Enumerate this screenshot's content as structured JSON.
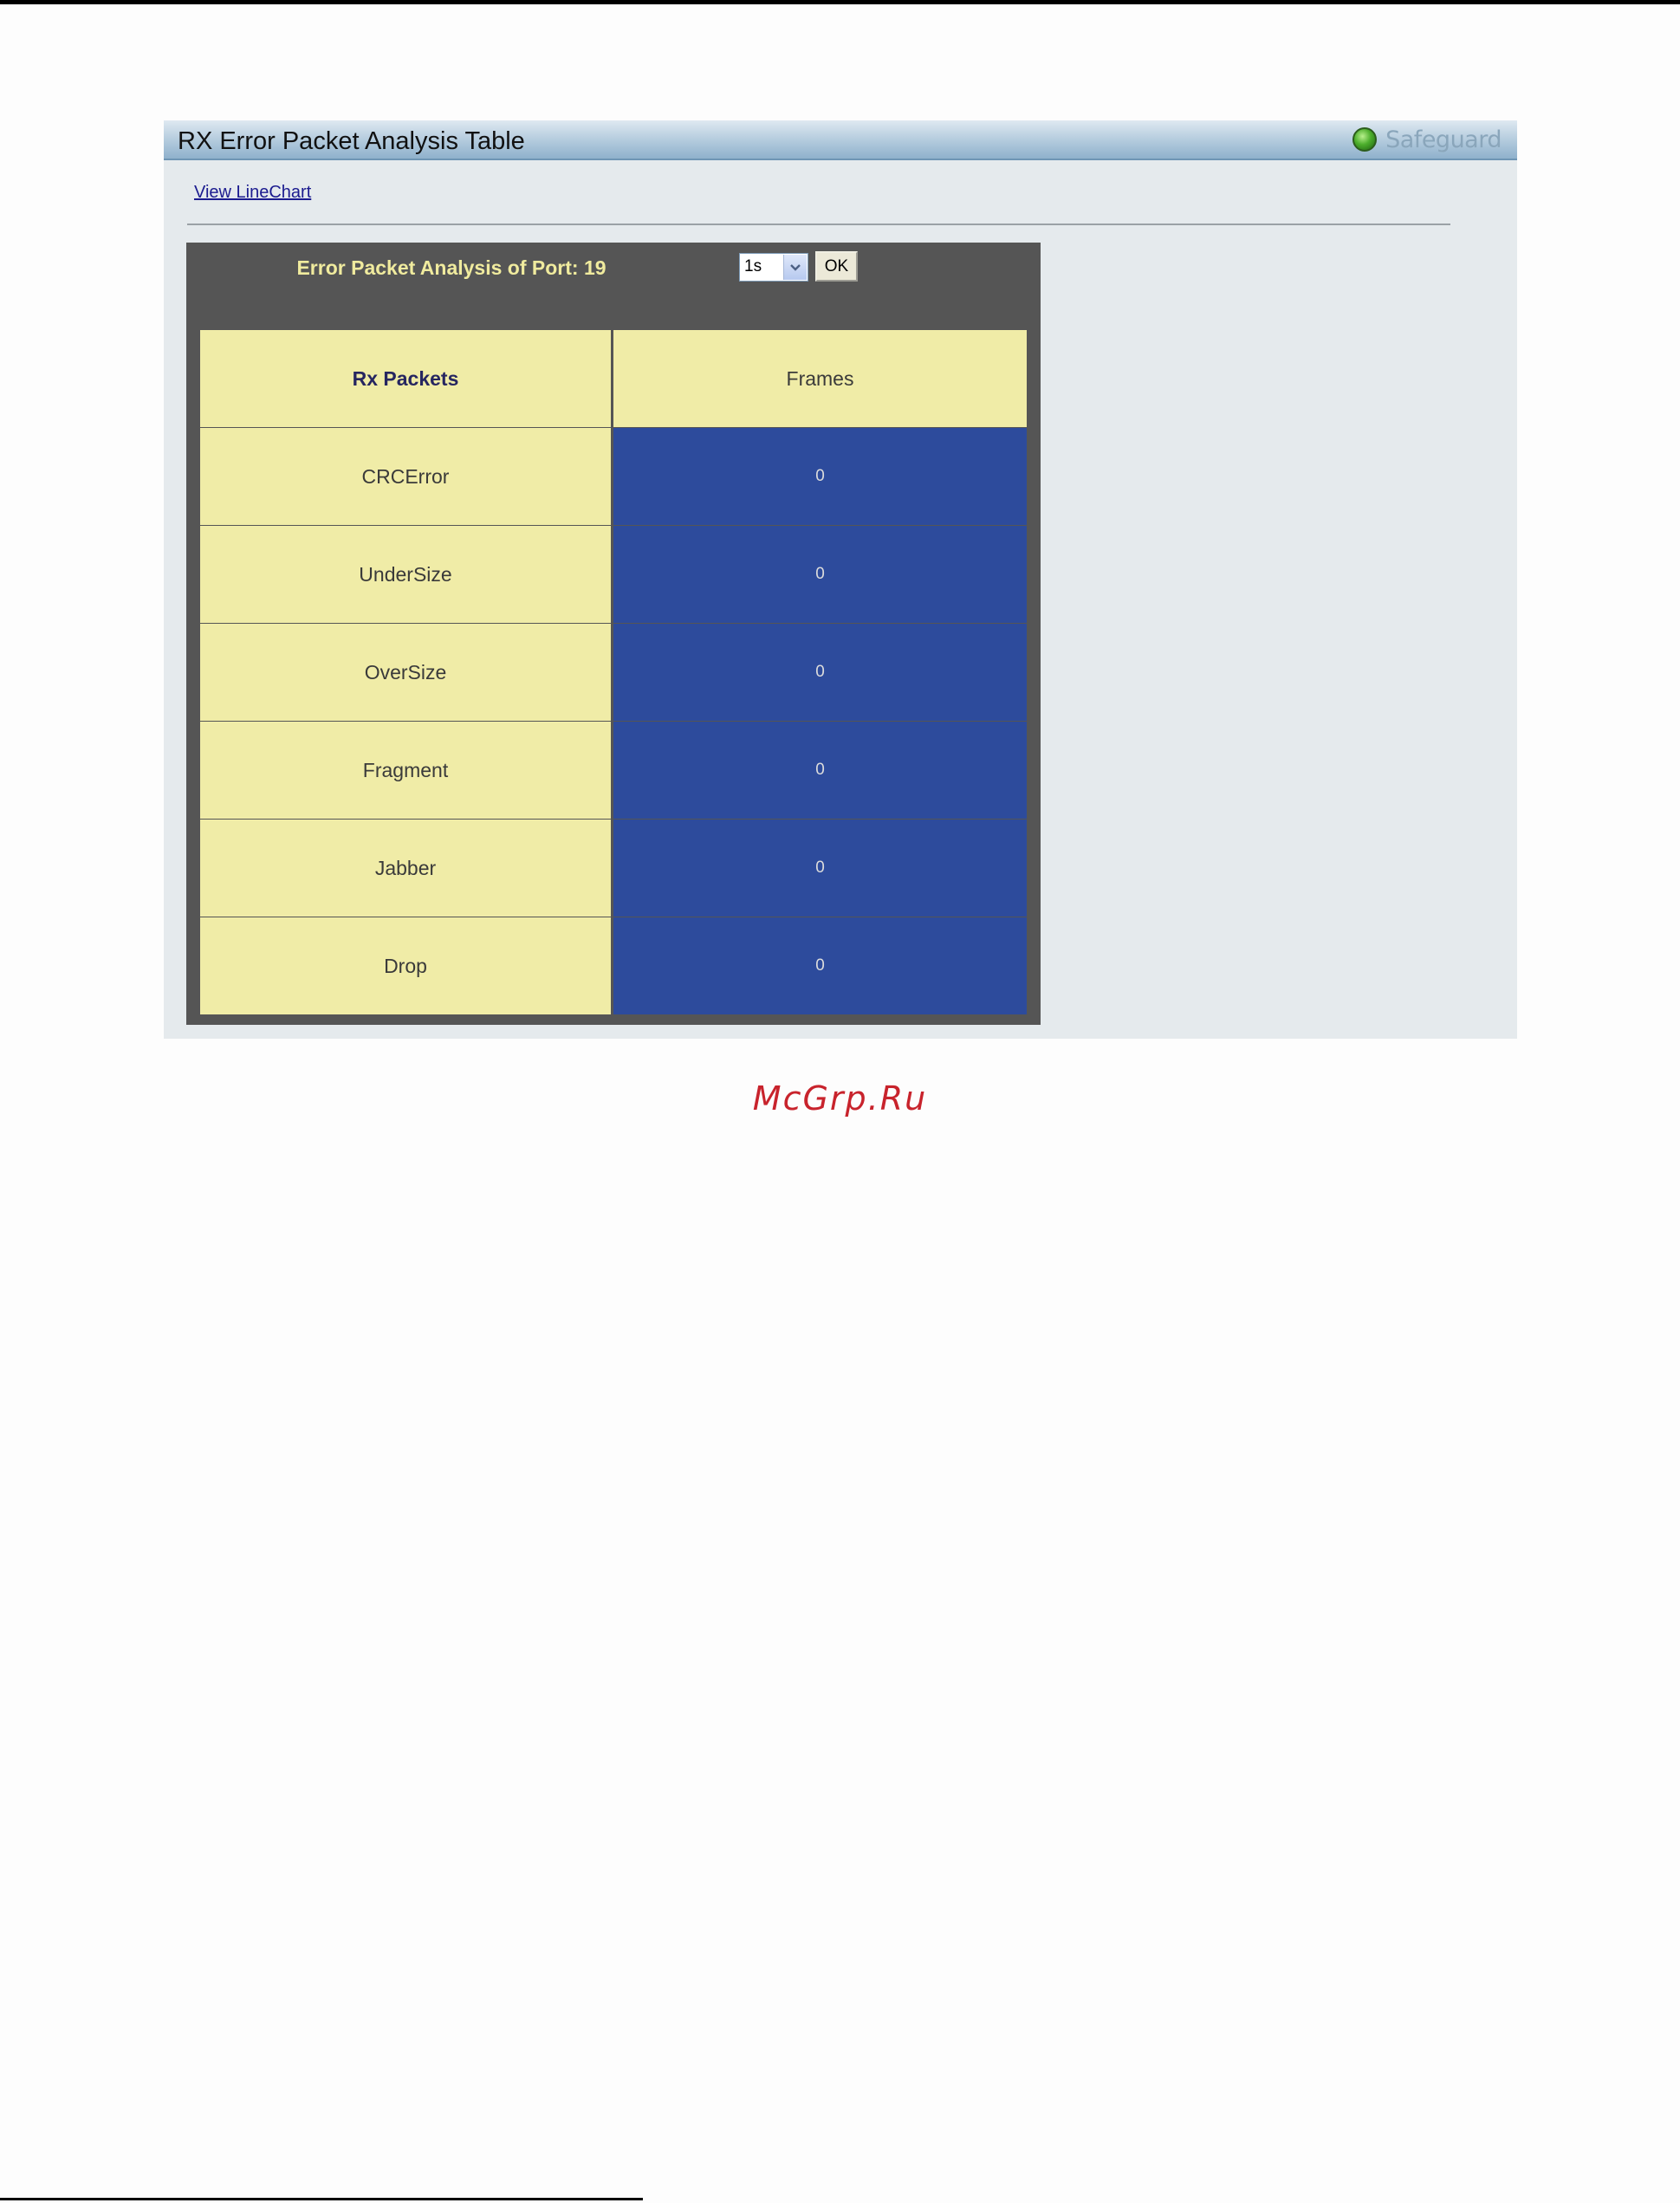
{
  "panel": {
    "title": "RX Error Packet Analysis Table",
    "safeguard_label": "Safeguard",
    "view_linechart": "View LineChart"
  },
  "analysis": {
    "title": "Error Packet Analysis of Port: 19",
    "interval_value": "1s",
    "ok_label": "OK"
  },
  "table": {
    "headers": [
      "Rx Packets",
      "Frames"
    ],
    "rows": [
      {
        "label": "CRCError",
        "value": "0"
      },
      {
        "label": "UnderSize",
        "value": "0"
      },
      {
        "label": "OverSize",
        "value": "0"
      },
      {
        "label": "Fragment",
        "value": "0"
      },
      {
        "label": "Jabber",
        "value": "0"
      },
      {
        "label": "Drop",
        "value": "0"
      }
    ]
  },
  "watermark": "McGrp.Ru",
  "colors": {
    "header_cell": "#f0eca7",
    "value_cell": "#2d4b9c",
    "box_background": "#555555",
    "box_title": "#f0eb9e",
    "watermark": "#c8232c"
  }
}
